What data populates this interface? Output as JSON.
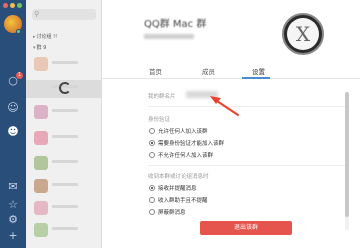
{
  "window": {
    "traffic_colors": [
      "#e96a5f",
      "#f2bf4f",
      "#6fc75a"
    ]
  },
  "rail": {
    "badge_count": "1",
    "icons": [
      "chat-icon",
      "contacts-icon",
      "groups-icon",
      "mail-icon",
      "star-icon",
      "settings-icon",
      "add-icon"
    ]
  },
  "list": {
    "groups": [
      {
        "label": "讨论组 !!"
      },
      {
        "label": "群 9"
      }
    ]
  },
  "group": {
    "name": "QQ群 Mac 群",
    "avatar_letter": "X"
  },
  "tabs": [
    {
      "label": "首页"
    },
    {
      "label": "成员"
    },
    {
      "label": "设置"
    }
  ],
  "settings": {
    "my_card_label": "我的群名片",
    "my_card_value": "",
    "verify_title": "身份验证",
    "verify_options": [
      {
        "label": "允许任何人加入该群",
        "selected": false
      },
      {
        "label": "需要身份验证才能加入该群",
        "selected": true
      },
      {
        "label": "不允许任何人加入该群",
        "selected": false
      }
    ],
    "notify_title": "收到本群或讨论组消息时",
    "notify_options": [
      {
        "label": "接收并提醒消息",
        "selected": true
      },
      {
        "label": "收入群助手且不提醒",
        "selected": false
      },
      {
        "label": "屏蔽群消息",
        "selected": false
      }
    ],
    "quit_label": "退出该群"
  },
  "colors": {
    "rail": "#2a4e7a",
    "accent": "#4a8bd7",
    "danger": "#e5544d",
    "annotation": "#e8432f"
  }
}
